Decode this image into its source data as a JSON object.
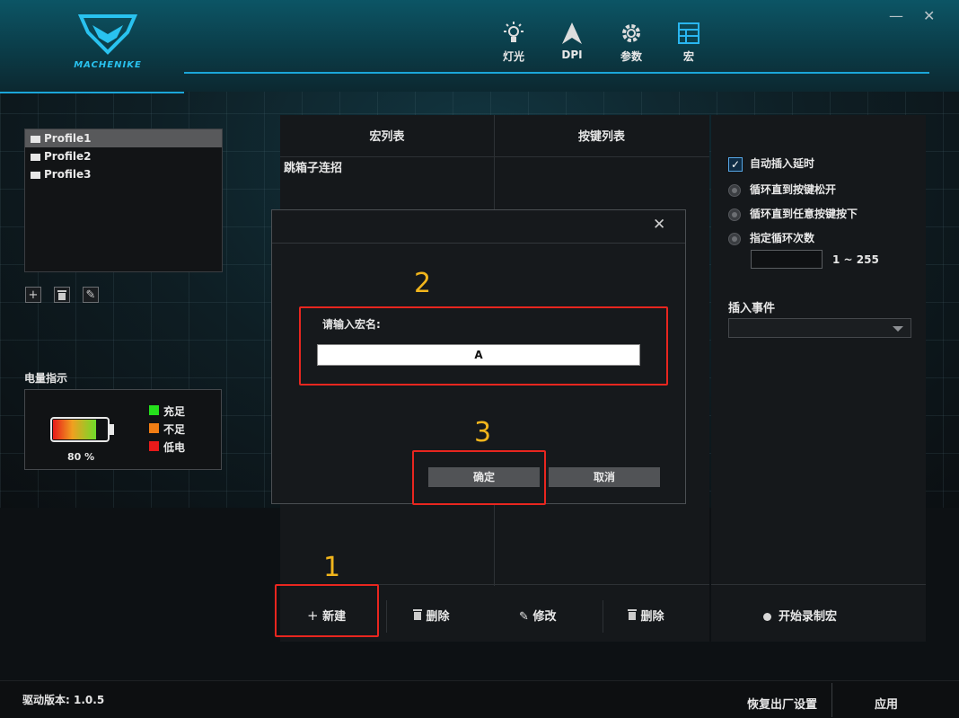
{
  "brand": {
    "name": "MACHENIKE",
    "accent": "#1ba6d9"
  },
  "window_controls": {
    "minimize": "—",
    "close": "✕"
  },
  "nav": [
    {
      "icon": "lightbulb-icon",
      "label": "灯光"
    },
    {
      "icon": "dpi-arrow-icon",
      "label": "DPI"
    },
    {
      "icon": "gear-icon",
      "label": "参数"
    },
    {
      "icon": "grid-icon",
      "label": "宏"
    }
  ],
  "profiles": {
    "items": [
      {
        "label": "Profile1",
        "selected": true
      },
      {
        "label": "Profile2",
        "selected": false
      },
      {
        "label": "Profile3",
        "selected": false
      }
    ],
    "buttons": {
      "add": "+",
      "delete": "🗑",
      "edit": "✎"
    }
  },
  "battery": {
    "title": "电量指示",
    "percent_text": "80 %",
    "level": 0.8,
    "legend": [
      {
        "label": "充足",
        "color": "#25e01c"
      },
      {
        "label": "不足",
        "color": "#f07d14"
      },
      {
        "label": "低电",
        "color": "#e81a1a"
      }
    ]
  },
  "macro_panel": {
    "col_macros": "宏列表",
    "col_keys": "按键列表",
    "macros": [
      "跳箱子连招"
    ],
    "new_btn": "新建",
    "delete_btn": "删除",
    "edit_btn": "修改",
    "delete_key_btn": "删除"
  },
  "right_panel": {
    "auto_delay": "自动插入延时",
    "loop_until_release": "循环直到按键松开",
    "loop_until_any": "循环直到任意按键按下",
    "loop_count": "指定循环次数",
    "range": "1 ~ 255",
    "insert_event": "插入事件",
    "record": "开始录制宏"
  },
  "dialog": {
    "prompt": "请输入宏名:",
    "value": "A",
    "ok": "确定",
    "cancel": "取消",
    "close": "✕"
  },
  "annotations": {
    "step1": "1",
    "step2": "2",
    "step3": "3",
    "box_color": "#e8261f",
    "num_color": "#f1b51c"
  },
  "footer": {
    "version_label": "驱动版本:",
    "version": "1.0.5",
    "reset": "恢复出厂设置",
    "apply": "应用"
  }
}
